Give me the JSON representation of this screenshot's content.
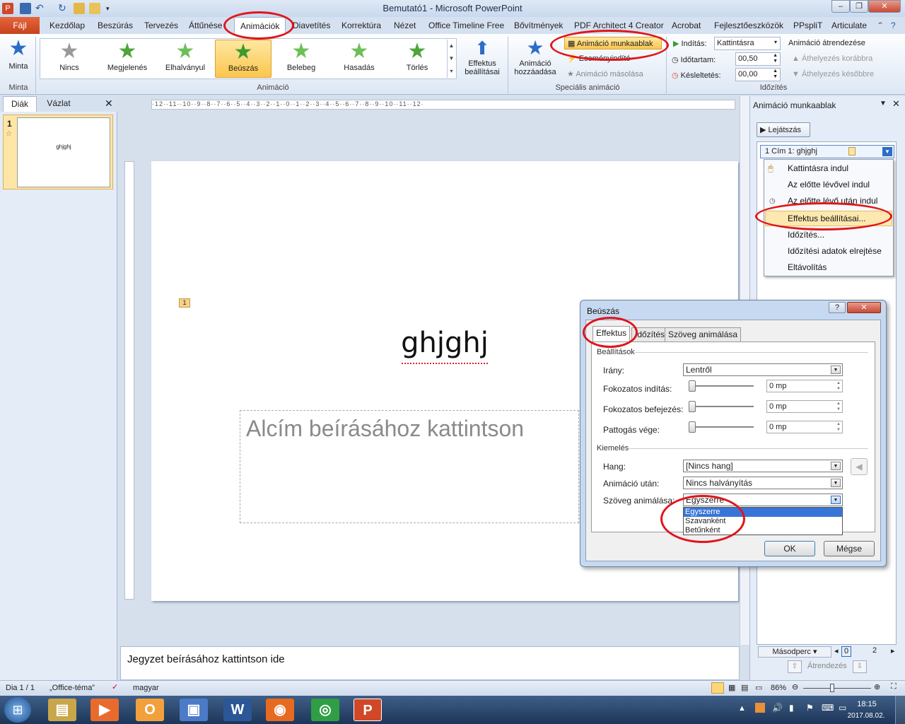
{
  "window": {
    "title": "Bemutató1 - Microsoft PowerPoint"
  },
  "tabs": [
    "Fájl",
    "Kezdőlap",
    "Beszúrás",
    "Tervezés",
    "Áttűnése",
    "Animációk",
    "Diavetítés",
    "Korrektúra",
    "Nézet",
    "Office Timeline Free",
    "Bővítmények",
    "PDF Architect 4 Creator",
    "Acrobat",
    "Fejlesztőeszközök",
    "PPspliT",
    "Articulate"
  ],
  "ribbon": {
    "preview": "Minta",
    "preview_group": "Minta",
    "gallery": [
      "Nincs",
      "Megjelenés",
      "Elhalványul",
      "Beúszás",
      "Belebeg",
      "Hasadás",
      "Törlés"
    ],
    "effect_options": "Effektus beállításai",
    "anim_group": "Animáció",
    "add_animation": "Animáció hozzáadása",
    "anim_pane": "Animáció munkaablak",
    "trigger": "Eseményindító",
    "painter": "Animáció másolása",
    "special_group": "Speciális animáció",
    "start_label": "Indítás:",
    "start_value": "Kattintásra",
    "duration_label": "Időtartam:",
    "duration_value": "00,50",
    "delay_label": "Késleltetés:",
    "delay_value": "00,00",
    "timing_group": "Időzítés",
    "reorder": "Animáció átrendezése",
    "move_earlier": "Áthelyezés korábbra",
    "move_later": "Áthelyezés későbbre"
  },
  "left_pane": {
    "tab_slides": "Diák",
    "tab_outline": "Vázlat",
    "slide_num": "1",
    "thumb_text": "ghjghj"
  },
  "slide": {
    "title": "ghjghj",
    "subtitle": "Alcím beírásához kattintson",
    "anim_marker": "1"
  },
  "notes": "Jegyzet beírásához kattintson ide",
  "anim_pane": {
    "title": "Animáció munkaablak",
    "play": "Lejátszás",
    "item": "1  Cím 1: ghjghj",
    "menu": [
      "Kattintásra indul",
      "Az előtte lévővel indul",
      "Az előtte lévő után indul",
      "Effektus beállításai...",
      "Időzítés...",
      "Időzítési adatok elrejtése",
      "Eltávolítás"
    ],
    "seconds": "Másodperc",
    "scale_0": "0",
    "scale_2": "2",
    "reorder": "Átrendezés"
  },
  "dialog": {
    "title": "Beúszás",
    "tabs": [
      "Effektus",
      "Időzítés",
      "Szöveg animálása"
    ],
    "section_settings": "Beállítások",
    "direction_label": "Irány:",
    "direction_value": "Lentről",
    "smooth_start_label": "Fokozatos indítás:",
    "smooth_end_label": "Fokozatos befejezés:",
    "bounce_end_label": "Pattogás vége:",
    "smooth_start_value": "0 mp",
    "smooth_end_value": "0 mp",
    "bounce_end_value": "0 mp",
    "section_enh": "Kiemelés",
    "sound_label": "Hang:",
    "sound_value": "[Nincs hang]",
    "after_label": "Animáció után:",
    "after_value": "Nincs halványítás",
    "text_anim_label": "Szöveg animálása:",
    "text_anim_value": "Egyszerre",
    "dropdown": [
      "Egyszerre",
      "Szavanként",
      "Betűnként"
    ],
    "ok": "OK",
    "cancel": "Mégse"
  },
  "status": {
    "slide": "Dia 1 / 1",
    "theme": "„Office-téma”",
    "lang": "magyar",
    "zoom": "86%"
  },
  "clock": {
    "time": "18:15",
    "date": "2017.08.02."
  },
  "colors": {
    "accent_red": "#e0151b",
    "file_tab": "#d24726",
    "highlight": "#fcc64d"
  }
}
